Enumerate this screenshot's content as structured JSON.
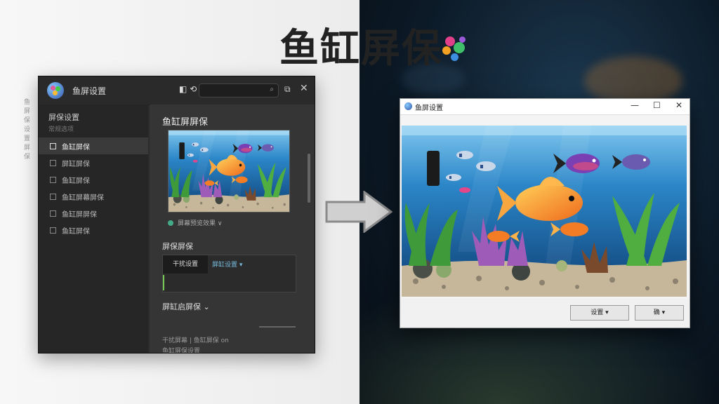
{
  "hero": {
    "title": "鱼缸屏保"
  },
  "settings": {
    "title": "鱼屏设置",
    "header_icons": "◧ ⟲",
    "search_icon": "search-icon",
    "sidebar_head": "屏保设置",
    "sidebar_sub": "常规选项",
    "items": [
      {
        "label": "鱼缸屏保"
      },
      {
        "label": "屏缸屏保"
      },
      {
        "label": "鱼缸屏保"
      },
      {
        "label": "鱼缸屏幕屏保"
      },
      {
        "label": "鱼缸屏屏保"
      },
      {
        "label": "鱼缸屏保"
      }
    ],
    "main_title": "鱼缸屏屏保",
    "preview_caption": "屏幕预览效果 ∨",
    "section_effect": "屏保屏保",
    "tab_active": "干扰设置",
    "tab_dropdown": "屏缸设置 ▾",
    "section_fish": "屏缸启屏保 ⌄",
    "footer_line1": "干扰屏幕 | 鱼缸屏保 on",
    "footer_line2": "鱼缸屏保设置"
  },
  "preview_window": {
    "title": "鱼屏设置",
    "minimize": "—",
    "maximize": "☐",
    "close": "✕",
    "btn_settings": "设置 ▾",
    "btn_ok": "确 ▾"
  },
  "faded_desktop": {
    "text": "鱼 屏 保 设 置 屏 保"
  },
  "colors": {
    "accent": "#4aa3df",
    "window_dark": "#2c2c2c",
    "water": "#1f6aa8",
    "fish_orange": "#f08a24"
  }
}
